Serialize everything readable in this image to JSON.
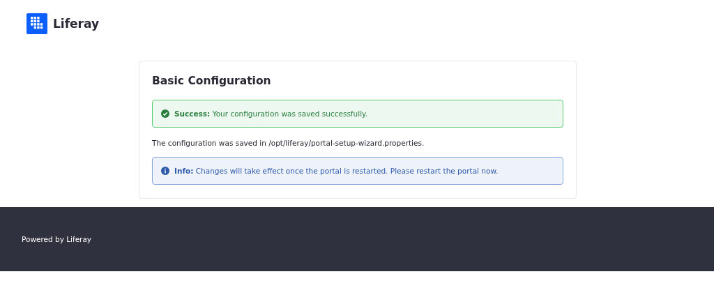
{
  "header": {
    "logo_text": "Liferay"
  },
  "card": {
    "title": "Basic Configuration",
    "items": [
      {
        "kind": "success",
        "label": "Success:",
        "text": "Your configuration was saved successfully."
      },
      {
        "kind": "text",
        "text": "The configuration was saved in /opt/liferay/portal-setup-wizard.properties."
      },
      {
        "kind": "info",
        "label": "Info:",
        "text": "Changes will take effect once the portal is restarted. Please restart the portal now."
      }
    ]
  },
  "footer": {
    "text": "Powered by Liferay"
  }
}
